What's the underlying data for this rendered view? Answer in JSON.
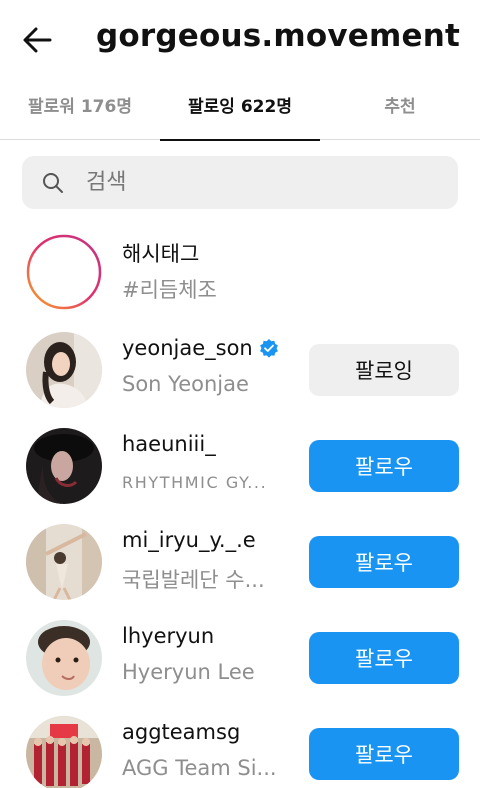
{
  "header": {
    "title": "gorgeous.movement",
    "back_icon": "arrow-left-icon"
  },
  "tabs": [
    {
      "label": "팔로워 176명",
      "active": false
    },
    {
      "label": "팔로잉 622명",
      "active": true
    },
    {
      "label": "추천",
      "active": false
    }
  ],
  "search": {
    "placeholder": "검색",
    "icon": "search-icon"
  },
  "list": [
    {
      "name": "해시태그",
      "sub": "#리듬체조",
      "verified": false,
      "button": ""
    },
    {
      "name": "yeonjae_son",
      "sub": "Son Yeonjae",
      "verified": true,
      "button": "팔로잉"
    },
    {
      "name": "haeuniii_",
      "sub": "RHYTHMIC GY...",
      "verified": false,
      "button": "팔로우"
    },
    {
      "name": "mi_iryu_y._.e",
      "sub": "국립발레단 수...",
      "verified": false,
      "button": "팔로우"
    },
    {
      "name": "lhyeryun",
      "sub": "Hyeryun Lee",
      "verified": false,
      "button": "팔로우"
    },
    {
      "name": "aggteamsg",
      "sub": "AGG Team Si...",
      "verified": false,
      "button": "팔로우"
    }
  ],
  "colors": {
    "follow_button": "#1a94f3",
    "following_button": "#efefef",
    "verified_badge": "#1a94f3"
  }
}
